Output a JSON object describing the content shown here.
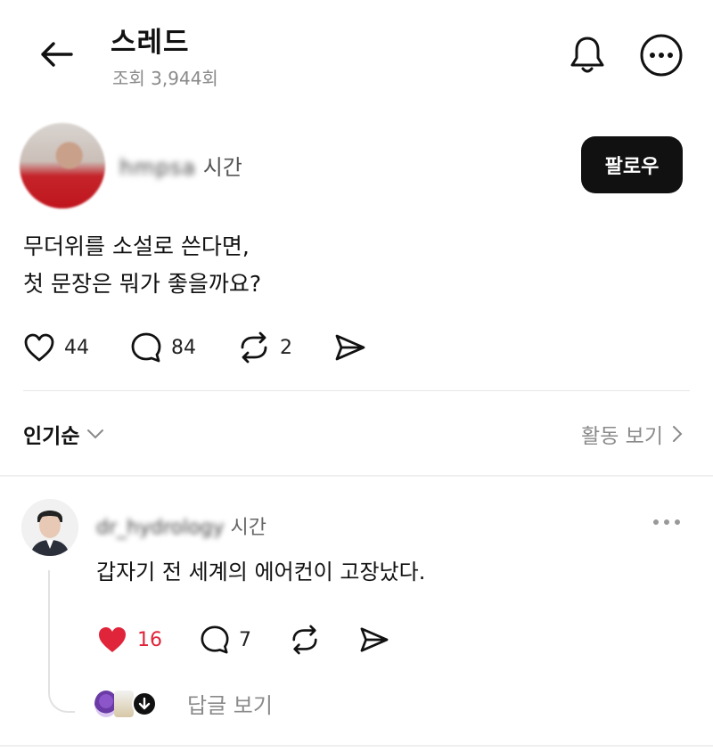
{
  "header": {
    "title": "스레드",
    "views": "조회 3,944회"
  },
  "post": {
    "username_blurred": "hmpsa",
    "time": "시간",
    "follow_label": "팔로우",
    "body_line1": "무더위를 소설로 쓴다면,",
    "body_line2": "첫 문장은 뭐가 좋을까요?",
    "likes": "44",
    "comments": "84",
    "reposts": "2"
  },
  "sort": {
    "label": "인기순",
    "activity_label": "활동 보기"
  },
  "comment": {
    "username_blurred": "dr_hydrology",
    "time": "시간",
    "body": "갑자기 전 세계의 에어컨이 고장났다.",
    "likes": "16",
    "comments": "7",
    "view_replies_label": "답글 보기"
  },
  "colors": {
    "like_active": "#e0243a",
    "follow_bg": "#111111",
    "muted_text": "#8a8a8a"
  }
}
